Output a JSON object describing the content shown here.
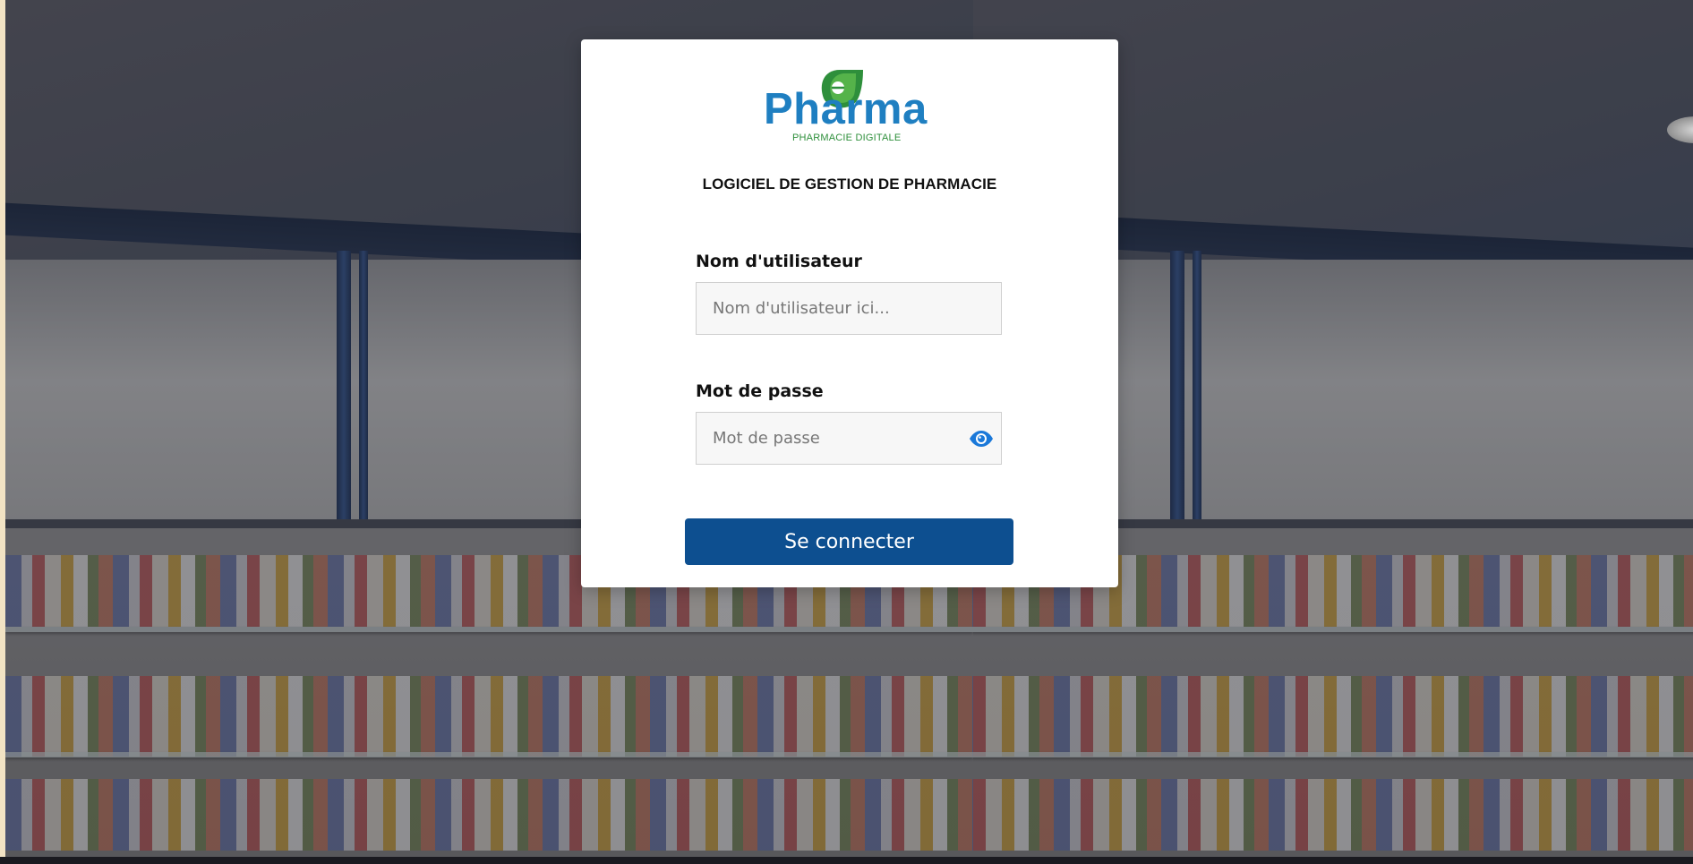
{
  "brand": {
    "logo_text": "Pharma",
    "logo_tagline": "PHARMACIE DIGITALE"
  },
  "app_subtitle": "LOGICIEL DE GESTION DE PHARMACIE",
  "login_form": {
    "username": {
      "label": "Nom d'utilisateur",
      "placeholder": "Nom d'utilisateur ici...",
      "value": ""
    },
    "password": {
      "label": "Mot de passe",
      "placeholder": "Mot de passe",
      "value": "",
      "toggle_icon": "eye-icon"
    },
    "submit_label": "Se connecter"
  },
  "colors": {
    "primary_button": "#0d4f90",
    "logo_blue": "#1f7fc1",
    "logo_green": "#2e8f3b",
    "eye_icon": "#1a78d9"
  }
}
